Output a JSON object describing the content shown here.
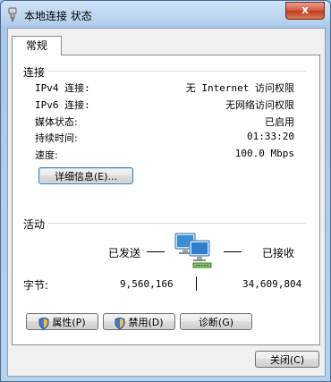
{
  "window": {
    "title": "本地连接 状态",
    "close_label": "x"
  },
  "tab": {
    "label": "常规"
  },
  "connection": {
    "group_label": "连接",
    "rows": [
      {
        "label": "IPv4 连接:",
        "value": "无 Internet 访问权限"
      },
      {
        "label": "IPv6 连接:",
        "value": "无网络访问权限"
      },
      {
        "label": "媒体状态:",
        "value": "已启用"
      },
      {
        "label": "持续时间:",
        "value": "01:33:20"
      },
      {
        "label": "速度:",
        "value": "100.0 Mbps"
      }
    ],
    "details_button": "详细信息(E)..."
  },
  "activity": {
    "group_label": "活动",
    "sent_label": "已发送",
    "received_label": "已接收",
    "bytes_label": "字节:",
    "sent_bytes": "9,560,166",
    "received_bytes": "34,609,804"
  },
  "buttons": {
    "properties": "属性(P)",
    "disable": "禁用(D)",
    "diagnose": "诊断(G)",
    "close": "关闭(C)"
  },
  "icons": {
    "title": "network-connection-icon",
    "activity": "network-computers-icon",
    "shield": "uac-shield-icon"
  },
  "colors": {
    "close_button": "#c8452a",
    "title_bar": "#b9d3ee",
    "panel": "#ffffff"
  }
}
